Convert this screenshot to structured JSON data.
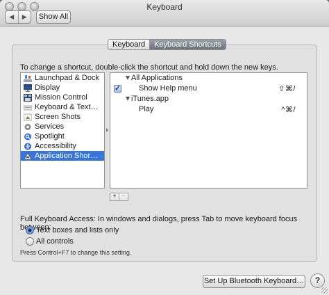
{
  "window": {
    "title": "Keyboard"
  },
  "toolbar": {
    "back_label": "◀",
    "forward_label": "▶",
    "show_all_label": "Show All"
  },
  "tabs": [
    {
      "label": "Keyboard",
      "active": false
    },
    {
      "label": "Keyboard Shortcuts",
      "active": true
    }
  ],
  "instruction": "To change a shortcut, double-click the shortcut and hold down the new keys.",
  "categories": [
    {
      "label": "Launchpad & Dock",
      "icon": "launchpad-icon",
      "selected": false
    },
    {
      "label": "Display",
      "icon": "display-icon",
      "selected": false
    },
    {
      "label": "Mission Control",
      "icon": "mission-control-icon",
      "selected": false
    },
    {
      "label": "Keyboard & Text…",
      "icon": "keyboard-icon",
      "selected": false
    },
    {
      "label": "Screen Shots",
      "icon": "screenshot-icon",
      "selected": false
    },
    {
      "label": "Services",
      "icon": "gear-icon",
      "selected": false
    },
    {
      "label": "Spotlight",
      "icon": "spotlight-icon",
      "selected": false
    },
    {
      "label": "Accessibility",
      "icon": "accessibility-icon",
      "selected": false
    },
    {
      "label": "Application Shor…",
      "icon": "app-shortcuts-icon",
      "selected": true
    }
  ],
  "shortcuts": {
    "groups": [
      {
        "label": "All Applications",
        "items": [
          {
            "label": "Show Help menu",
            "keys": "⇧⌘/",
            "checked": true
          }
        ]
      },
      {
        "label": "iTunes.app",
        "items": [
          {
            "label": "Play",
            "keys": "^⌘/",
            "checked": false
          }
        ]
      }
    ],
    "add_label": "+",
    "remove_label": "−"
  },
  "full_keyboard_access": {
    "label": "Full Keyboard Access: In windows and dialogs, press Tab to move keyboard focus between:",
    "options": [
      {
        "label": "Text boxes and lists only",
        "selected": true
      },
      {
        "label": "All controls",
        "selected": false
      }
    ],
    "hint": "Press Control+F7 to change this setting."
  },
  "footer": {
    "bluetooth_label": "Set Up Bluetooth Keyboard…",
    "help_label": "?"
  },
  "colors": {
    "selection": "#3875d7",
    "tab_active": "#7d838d",
    "window_bg": "#e8e8e8"
  }
}
